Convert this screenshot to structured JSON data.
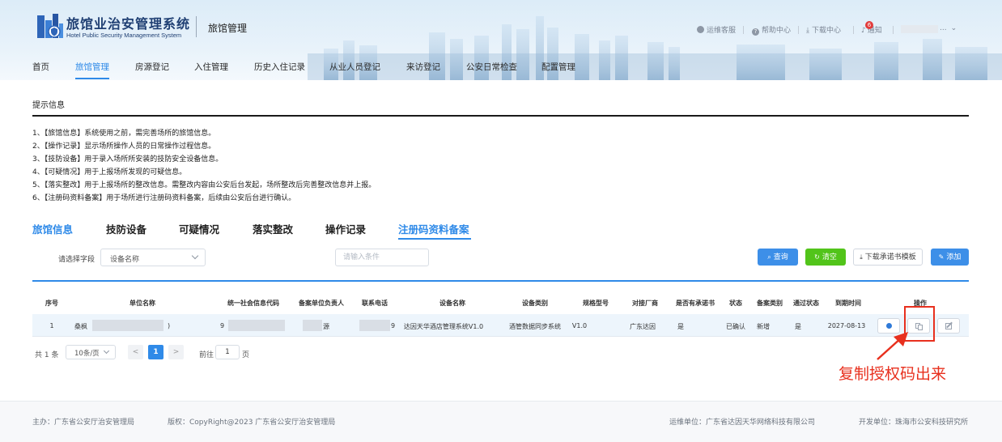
{
  "header": {
    "logo_title": "旅馆业治安管理系统",
    "logo_subtitle": "Hotel Public Security Management System",
    "module_title": "旅馆管理",
    "top_links": [
      {
        "label": "运维客服",
        "icon": "headset-icon"
      },
      {
        "label": "帮助中心",
        "icon": "help-icon"
      },
      {
        "label": "下载中心",
        "icon": "download-icon"
      },
      {
        "label": "通知",
        "icon": "bell-icon",
        "badge": "6"
      }
    ],
    "user_suffix": "...",
    "nav": [
      "首页",
      "旅馆管理",
      "房源登记",
      "入住管理",
      "历史入住记录",
      "从业人员登记",
      "来访登记",
      "公安日常检查",
      "配置管理"
    ],
    "active_nav": "旅馆管理"
  },
  "tips": {
    "title": "提示信息",
    "items": [
      "1、【旅馆信息】系统使用之前，需完善场所的旅馆信息。",
      "2、【操作记录】显示场所操作人员的日常操作过程信息。",
      "3、【技防设备】用于录入场所所安装的技防安全设备信息。",
      "4、【可疑情况】用于上报场所发现的可疑信息。",
      "5、【落实整改】用于上报场所的整改信息。需整改内容由公安后台发起，场所整改后完善整改信息并上报。",
      "6、【注册码资料备案】用于场所进行注册码资料备案，后续由公安后台进行确认。"
    ]
  },
  "tabs": [
    "旅馆信息",
    "技防设备",
    "可疑情况",
    "落实整改",
    "操作记录",
    "注册码资料备案"
  ],
  "active_tab": "注册码资料备案",
  "filter": {
    "label": "请选择字段",
    "field_value": "设备名称",
    "condition_placeholder": "请输入条件",
    "query": "查询",
    "clear": "清空",
    "download_template": "下载承诺书模板",
    "add": "添加"
  },
  "table": {
    "columns": [
      "序号",
      "单位名称",
      "统一社会信息代码",
      "备案单位负责人",
      "联系电话",
      "设备名称",
      "设备类别",
      "规格型号",
      "对接厂商",
      "是否有承诺书",
      "状态",
      "备案类别",
      "通过状态",
      "到期时间",
      "操作"
    ],
    "rows": [
      {
        "index": "1",
        "unit_name": "桑枫",
        "unit_name_tail": ")",
        "credit_code": "9",
        "manager": "源",
        "phone": "9",
        "device_name": "达因天华酒店管理系统V1.0",
        "device_category": "酒管数据同步系统",
        "model": "V1.0",
        "vendor": "广东达因",
        "has_commitment": "是",
        "status": "已确认",
        "record_type": "新增",
        "pass_status": "是",
        "expire": "2027-08-13"
      }
    ]
  },
  "annotation": "复制授权码出来",
  "pagination": {
    "total": "共 1 条",
    "page_size": "10条/页",
    "prev": "<",
    "current": "1",
    "next": ">",
    "goto_label": "前往",
    "goto_value": "1",
    "goto_suffix": "页"
  },
  "footer": {
    "host": "主办：广东省公安厅治安管理局",
    "copyright": "版权：CopyRight@2023 广东省公安厅治安管理局",
    "maintainer": "运维单位：广东省达因天华网络科技有限公司",
    "developer": "开发单位：珠海市公安科技研究所"
  },
  "colors": {
    "primary": "#2f8ae8",
    "clear_green": "#52c41a",
    "annotation_red": "#e8301e",
    "notice_red": "#e23b3b"
  }
}
